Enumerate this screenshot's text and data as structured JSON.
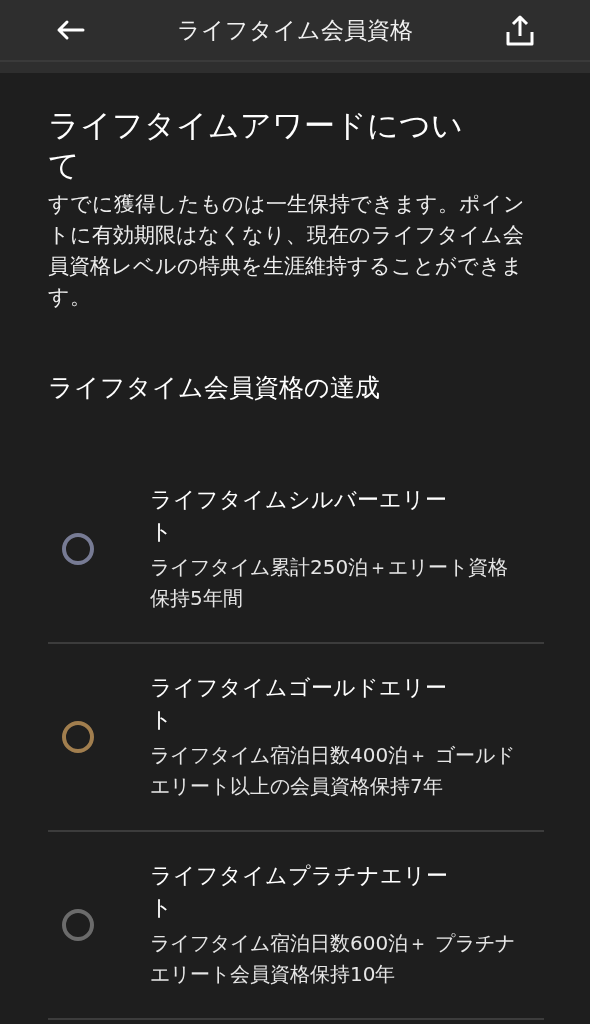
{
  "header": {
    "title": "ライフタイム会員資格"
  },
  "about": {
    "heading": "ライフタイムアワードについて",
    "body": "すでに獲得したものは一生保持できます。ポイントに有効期限はなくなり、現在のライフタイム会員資格レベルの特典を生涯維持することができます。"
  },
  "achievements": {
    "heading": "ライフタイム会員資格の達成",
    "items": [
      {
        "title": "ライフタイムシルバーエリート",
        "description": "ライフタイム累計250泊＋エリート資格保持5年間",
        "color": "#777b94"
      },
      {
        "title": "ライフタイムゴールドエリート",
        "description": "ライフタイム宿泊日数400泊＋ ゴールドエリート以上の会員資格保持7年",
        "color": "#a17e4e"
      },
      {
        "title": "ライフタイムプラチナエリート",
        "description": "ライフタイム宿泊日数600泊＋ プラチナエリート会員資格保持10年",
        "color": "#6b6b6b"
      }
    ]
  }
}
